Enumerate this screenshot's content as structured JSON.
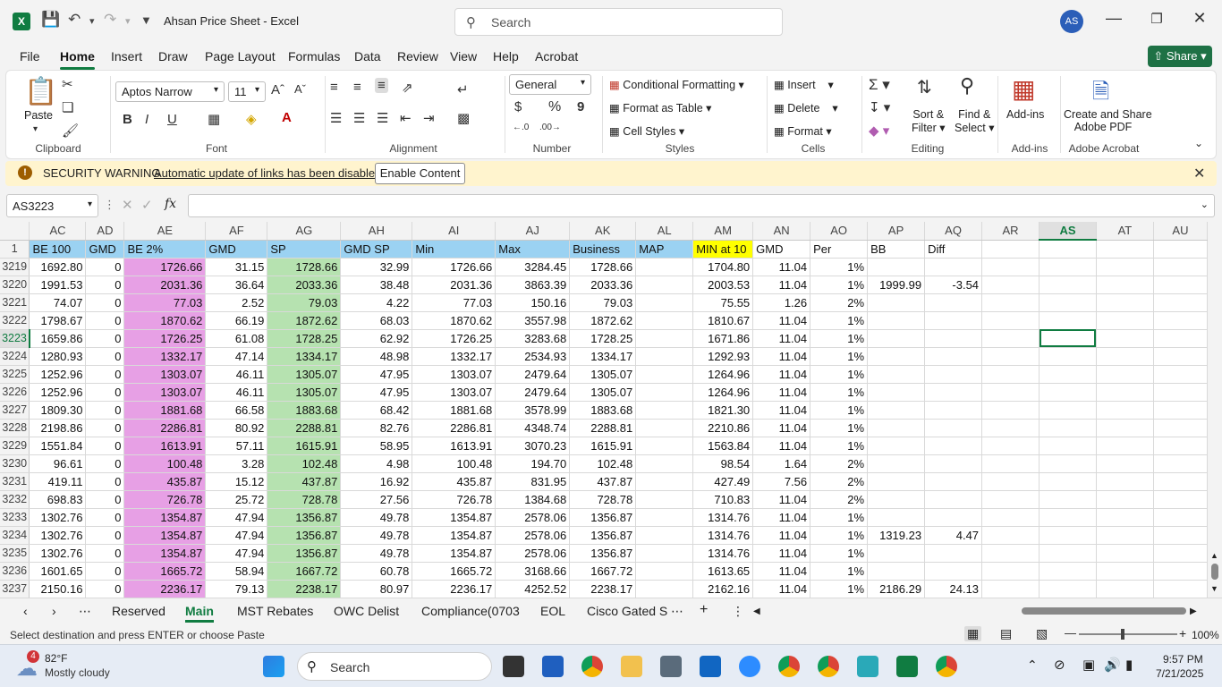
{
  "app": {
    "title": "Ahsan Price Sheet  -  Excel",
    "search_placeholder": "Search",
    "user_initials": "AS",
    "share_label": "Share"
  },
  "menu_tabs": [
    "File",
    "Home",
    "Insert",
    "Draw",
    "Page Layout",
    "Formulas",
    "Data",
    "Review",
    "View",
    "Help",
    "Acrobat"
  ],
  "ribbon": {
    "clipboard": {
      "paste": "Paste",
      "group": "Clipboard"
    },
    "font": {
      "family": "Aptos Narrow",
      "size": "11",
      "group": "Font"
    },
    "alignment": {
      "group": "Alignment"
    },
    "number": {
      "format": "General",
      "currency": "$",
      "percent": "%",
      "comma": "9",
      "group": "Number"
    },
    "styles": {
      "cond": "Conditional Formatting",
      "table": "Format as Table",
      "cell": "Cell Styles",
      "group": "Styles"
    },
    "cells": {
      "insert": "Insert",
      "delete": "Delete",
      "format": "Format",
      "group": "Cells"
    },
    "editing": {
      "sort1": "Sort &",
      "sort2": "Filter",
      "find1": "Find &",
      "find2": "Select",
      "group": "Editing"
    },
    "addins": {
      "label": "Add-ins",
      "group": "Add-ins"
    },
    "acrobat": {
      "line1": "Create and Share",
      "line2": "Adobe PDF",
      "group": "Adobe Acrobat"
    }
  },
  "warning": {
    "title": "SECURITY WARNING",
    "message": "Automatic update of links has been disabled",
    "button": "Enable Content"
  },
  "formula_bar": {
    "name_box": "AS3223",
    "fx": "fx",
    "value": ""
  },
  "columns": [
    "AC",
    "AD",
    "AE",
    "AF",
    "AG",
    "AH",
    "AI",
    "AJ",
    "AK",
    "AL",
    "AM",
    "AN",
    "AO",
    "AP",
    "AQ",
    "AR",
    "AS",
    "AT",
    "AU"
  ],
  "header_row": {
    "num": "1",
    "cells": [
      "BE 100",
      "GMD",
      "BE 2%",
      "GMD",
      "SP",
      "GMD SP",
      "Min",
      "Max",
      "Business",
      "MAP",
      "MIN at 10",
      "GMD",
      "Per",
      "BB",
      "Diff",
      "",
      "",
      "",
      ""
    ]
  },
  "rows": [
    {
      "num": "3219",
      "cells": [
        "1692.80",
        "0",
        "1726.66",
        "31.15",
        "1728.66",
        "32.99",
        "1726.66",
        "3284.45",
        "1728.66",
        "",
        "1704.80",
        "11.04",
        "1%",
        "",
        "",
        "",
        "",
        "",
        ""
      ]
    },
    {
      "num": "3220",
      "cells": [
        "1991.53",
        "0",
        "2031.36",
        "36.64",
        "2033.36",
        "38.48",
        "2031.36",
        "3863.39",
        "2033.36",
        "",
        "2003.53",
        "11.04",
        "1%",
        "1999.99",
        "-3.54",
        "",
        "",
        "",
        ""
      ]
    },
    {
      "num": "3221",
      "cells": [
        "74.07",
        "0",
        "77.03",
        "2.52",
        "79.03",
        "4.22",
        "77.03",
        "150.16",
        "79.03",
        "",
        "75.55",
        "1.26",
        "2%",
        "",
        "",
        "",
        "",
        "",
        ""
      ]
    },
    {
      "num": "3222",
      "cells": [
        "1798.67",
        "0",
        "1870.62",
        "66.19",
        "1872.62",
        "68.03",
        "1870.62",
        "3557.98",
        "1872.62",
        "",
        "1810.67",
        "11.04",
        "1%",
        "",
        "",
        "",
        "",
        "",
        ""
      ]
    },
    {
      "num": "3223",
      "cells": [
        "1659.86",
        "0",
        "1726.25",
        "61.08",
        "1728.25",
        "62.92",
        "1726.25",
        "3283.68",
        "1728.25",
        "",
        "1671.86",
        "11.04",
        "1%",
        "",
        "",
        "",
        "",
        "",
        ""
      ]
    },
    {
      "num": "3224",
      "cells": [
        "1280.93",
        "0",
        "1332.17",
        "47.14",
        "1334.17",
        "48.98",
        "1332.17",
        "2534.93",
        "1334.17",
        "",
        "1292.93",
        "11.04",
        "1%",
        "",
        "",
        "",
        "",
        "",
        ""
      ]
    },
    {
      "num": "3225",
      "cells": [
        "1252.96",
        "0",
        "1303.07",
        "46.11",
        "1305.07",
        "47.95",
        "1303.07",
        "2479.64",
        "1305.07",
        "",
        "1264.96",
        "11.04",
        "1%",
        "",
        "",
        "",
        "",
        "",
        ""
      ]
    },
    {
      "num": "3226",
      "cells": [
        "1252.96",
        "0",
        "1303.07",
        "46.11",
        "1305.07",
        "47.95",
        "1303.07",
        "2479.64",
        "1305.07",
        "",
        "1264.96",
        "11.04",
        "1%",
        "",
        "",
        "",
        "",
        "",
        ""
      ]
    },
    {
      "num": "3227",
      "cells": [
        "1809.30",
        "0",
        "1881.68",
        "66.58",
        "1883.68",
        "68.42",
        "1881.68",
        "3578.99",
        "1883.68",
        "",
        "1821.30",
        "11.04",
        "1%",
        "",
        "",
        "",
        "",
        "",
        ""
      ]
    },
    {
      "num": "3228",
      "cells": [
        "2198.86",
        "0",
        "2286.81",
        "80.92",
        "2288.81",
        "82.76",
        "2286.81",
        "4348.74",
        "2288.81",
        "",
        "2210.86",
        "11.04",
        "1%",
        "",
        "",
        "",
        "",
        "",
        ""
      ]
    },
    {
      "num": "3229",
      "cells": [
        "1551.84",
        "0",
        "1613.91",
        "57.11",
        "1615.91",
        "58.95",
        "1613.91",
        "3070.23",
        "1615.91",
        "",
        "1563.84",
        "11.04",
        "1%",
        "",
        "",
        "",
        "",
        "",
        ""
      ]
    },
    {
      "num": "3230",
      "cells": [
        "96.61",
        "0",
        "100.48",
        "3.28",
        "102.48",
        "4.98",
        "100.48",
        "194.70",
        "102.48",
        "",
        "98.54",
        "1.64",
        "2%",
        "",
        "",
        "",
        "",
        "",
        ""
      ]
    },
    {
      "num": "3231",
      "cells": [
        "419.11",
        "0",
        "435.87",
        "15.12",
        "437.87",
        "16.92",
        "435.87",
        "831.95",
        "437.87",
        "",
        "427.49",
        "7.56",
        "2%",
        "",
        "",
        "",
        "",
        "",
        ""
      ]
    },
    {
      "num": "3232",
      "cells": [
        "698.83",
        "0",
        "726.78",
        "25.72",
        "728.78",
        "27.56",
        "726.78",
        "1384.68",
        "728.78",
        "",
        "710.83",
        "11.04",
        "2%",
        "",
        "",
        "",
        "",
        "",
        ""
      ]
    },
    {
      "num": "3233",
      "cells": [
        "1302.76",
        "0",
        "1354.87",
        "47.94",
        "1356.87",
        "49.78",
        "1354.87",
        "2578.06",
        "1356.87",
        "",
        "1314.76",
        "11.04",
        "1%",
        "",
        "",
        "",
        "",
        "",
        ""
      ]
    },
    {
      "num": "3234",
      "cells": [
        "1302.76",
        "0",
        "1354.87",
        "47.94",
        "1356.87",
        "49.78",
        "1354.87",
        "2578.06",
        "1356.87",
        "",
        "1314.76",
        "11.04",
        "1%",
        "1319.23",
        "4.47",
        "",
        "",
        "",
        ""
      ]
    },
    {
      "num": "3235",
      "cells": [
        "1302.76",
        "0",
        "1354.87",
        "47.94",
        "1356.87",
        "49.78",
        "1354.87",
        "2578.06",
        "1356.87",
        "",
        "1314.76",
        "11.04",
        "1%",
        "",
        "",
        "",
        "",
        "",
        ""
      ]
    },
    {
      "num": "3236",
      "cells": [
        "1601.65",
        "0",
        "1665.72",
        "58.94",
        "1667.72",
        "60.78",
        "1665.72",
        "3168.66",
        "1667.72",
        "",
        "1613.65",
        "11.04",
        "1%",
        "",
        "",
        "",
        "",
        "",
        ""
      ]
    },
    {
      "num": "3237",
      "cells": [
        "2150.16",
        "0",
        "2236.17",
        "79.13",
        "2238.17",
        "80.97",
        "2236.17",
        "4252.52",
        "2238.17",
        "",
        "2162.16",
        "11.04",
        "1%",
        "2186.29",
        "24.13",
        "",
        "",
        "",
        ""
      ]
    }
  ],
  "sheet_tabs": [
    "Reserved",
    "Main",
    "MST Rebates",
    "OWC Delist",
    "Compliance(0703",
    "EOL",
    "Cisco Gated S"
  ],
  "active_sheet": "Main",
  "status": {
    "message": "Select destination and press ENTER or choose Paste",
    "zoom": "100%"
  },
  "taskbar": {
    "weather_badge": "4",
    "temp": "82°F",
    "weather": "Mostly cloudy",
    "search": "Search",
    "time": "9:57 PM",
    "date": "7/21/2025"
  },
  "colors": {
    "accent": "#107c41",
    "blue_col": "#9bd2f2",
    "pink_col": "#e7a0e5",
    "green_col": "#b6e2b0",
    "yellow_col": "#ffff00"
  }
}
